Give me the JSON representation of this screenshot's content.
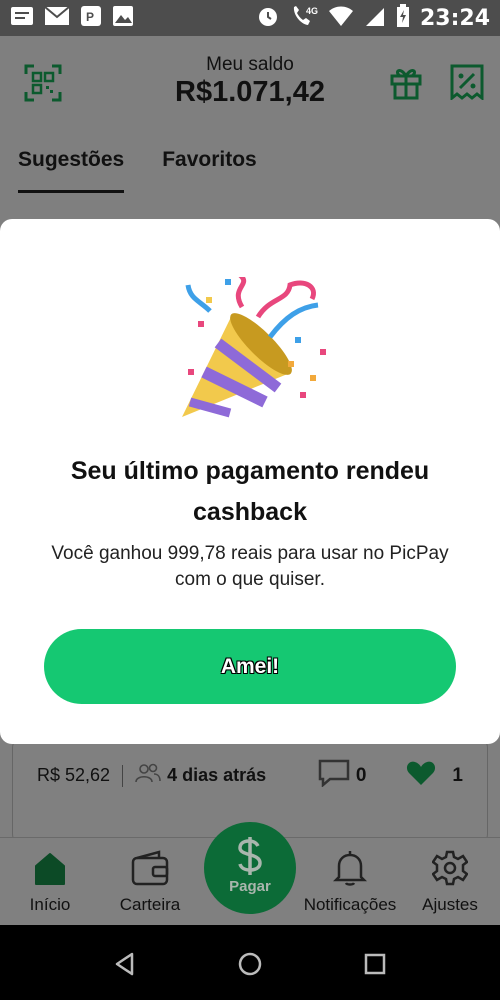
{
  "status_bar": {
    "time": "23:24",
    "network": "4G"
  },
  "header": {
    "balance_label": "Meu saldo",
    "balance_value": "R$1.071,42"
  },
  "tabs": [
    "Sugestões",
    "Favoritos"
  ],
  "feed_card": {
    "price": "R$ 52,62",
    "time_ago": "4 dias atrás",
    "comments": "0",
    "likes": "1"
  },
  "bottom_nav": {
    "inicio": "Início",
    "carteira": "Carteira",
    "pagar": "Pagar",
    "notificacoes": "Notificações",
    "ajustes": "Ajustes"
  },
  "modal": {
    "title": "Seu último pagamento rendeu cashback",
    "body": "Você ganhou 999,78 reais para usar no PicPay com o que quiser.",
    "button": "Amei!"
  },
  "colors": {
    "accent": "#15c872",
    "brand_dark": "#0c6b37",
    "overlay": "#7f7f7f"
  }
}
